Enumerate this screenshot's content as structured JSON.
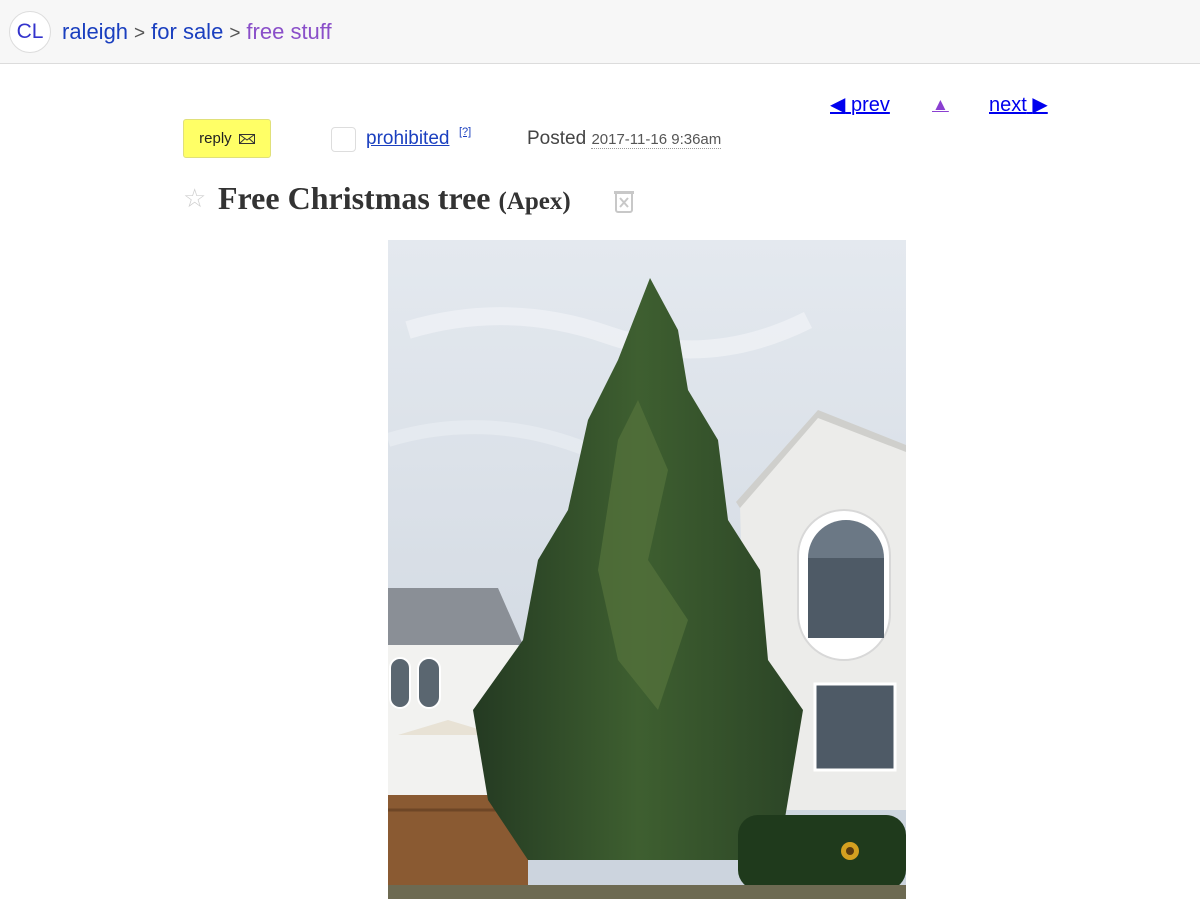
{
  "header": {
    "logo": "CL",
    "breadcrumbs": [
      "raleigh",
      "for sale",
      "free stuff"
    ],
    "separator": ">"
  },
  "nav": {
    "prev_label": "prev",
    "next_label": "next"
  },
  "posting": {
    "reply_label": "reply",
    "flag_label": "prohibited",
    "flag_help": "[?]",
    "posted_label": "Posted",
    "posted_date": "2017-11-16 9:36am",
    "title": "Free Christmas tree",
    "location": "(Apex)"
  },
  "icons": [
    "cl-logo",
    "left-arrow-icon",
    "up-arrow-icon",
    "right-arrow-icon",
    "envelope-icon",
    "star-icon",
    "hide-icon"
  ],
  "colors": {
    "link": "#1a3fbf",
    "visited": "#8a4fc9",
    "reply_bg": "#ffff66"
  }
}
